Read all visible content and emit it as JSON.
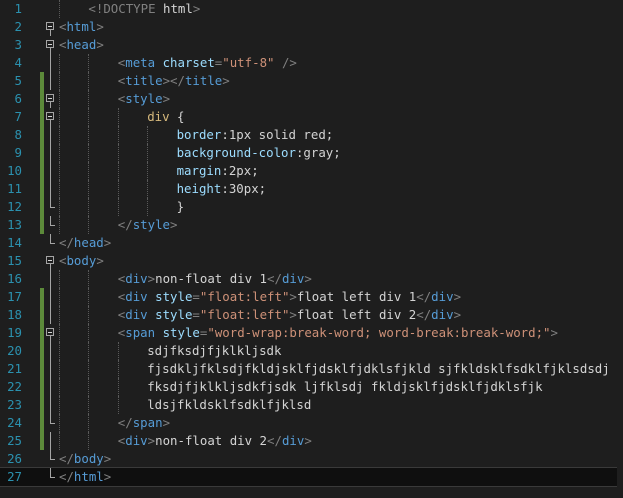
{
  "editor": {
    "current_line": 27,
    "colors": {
      "background": "#1e1e1e",
      "line_number": "#2b91af",
      "delimiter": "#808080",
      "tag": "#569cd6",
      "attribute": "#9cdcfe",
      "string": "#ce9178",
      "selector": "#d7ba7d",
      "text": "#d4d4d4",
      "change_marker": "#5c8a3a"
    },
    "lines": [
      {
        "n": "1",
        "indent": 1,
        "modified": false,
        "fold": "none",
        "tokens": [
          [
            "delim",
            "<!"
          ],
          [
            "doctype",
            "DOCTYPE "
          ],
          [
            "doctype-kw",
            "html"
          ],
          [
            "delim",
            ">"
          ]
        ]
      },
      {
        "n": "2",
        "indent": 0,
        "modified": false,
        "fold": "open",
        "tokens": [
          [
            "delim",
            "<"
          ],
          [
            "tag",
            "html"
          ],
          [
            "delim",
            ">"
          ]
        ]
      },
      {
        "n": "3",
        "indent": 0,
        "modified": false,
        "fold": "open",
        "tokens": [
          [
            "delim",
            "<"
          ],
          [
            "tag",
            "head"
          ],
          [
            "delim",
            ">"
          ]
        ]
      },
      {
        "n": "4",
        "indent": 2,
        "modified": false,
        "fold": "line",
        "tokens": [
          [
            "delim",
            "<"
          ],
          [
            "tag",
            "meta "
          ],
          [
            "attr",
            "charset"
          ],
          [
            "delim",
            "="
          ],
          [
            "str",
            "\"utf-8\""
          ],
          [
            "delim",
            " />"
          ]
        ]
      },
      {
        "n": "5",
        "indent": 2,
        "modified": true,
        "fold": "line",
        "tokens": [
          [
            "delim",
            "<"
          ],
          [
            "tag",
            "title"
          ],
          [
            "delim",
            "></"
          ],
          [
            "tag",
            "title"
          ],
          [
            "delim",
            ">"
          ]
        ]
      },
      {
        "n": "6",
        "indent": 2,
        "modified": true,
        "fold": "open",
        "tokens": [
          [
            "delim",
            "<"
          ],
          [
            "tag",
            "style"
          ],
          [
            "delim",
            ">"
          ]
        ]
      },
      {
        "n": "7",
        "indent": 3,
        "modified": true,
        "fold": "open",
        "tokens": [
          [
            "sel",
            "div "
          ],
          [
            "text",
            "{"
          ]
        ]
      },
      {
        "n": "8",
        "indent": 4,
        "modified": true,
        "fold": "line",
        "tokens": [
          [
            "prop",
            "border"
          ],
          [
            "text",
            ":1px solid red;"
          ]
        ]
      },
      {
        "n": "9",
        "indent": 4,
        "modified": true,
        "fold": "line",
        "tokens": [
          [
            "prop",
            "background-color"
          ],
          [
            "text",
            ":gray;"
          ]
        ]
      },
      {
        "n": "10",
        "indent": 4,
        "modified": true,
        "fold": "line",
        "tokens": [
          [
            "prop",
            "margin"
          ],
          [
            "text",
            ":2px;"
          ]
        ]
      },
      {
        "n": "11",
        "indent": 4,
        "modified": true,
        "fold": "line",
        "tokens": [
          [
            "prop",
            "height"
          ],
          [
            "text",
            ":30px;"
          ]
        ]
      },
      {
        "n": "12",
        "indent": 4,
        "modified": true,
        "fold": "end",
        "tokens": [
          [
            "text",
            "}"
          ]
        ]
      },
      {
        "n": "13",
        "indent": 2,
        "modified": true,
        "fold": "end",
        "tokens": [
          [
            "delim",
            "</"
          ],
          [
            "tag",
            "style"
          ],
          [
            "delim",
            ">"
          ]
        ]
      },
      {
        "n": "14",
        "indent": 0,
        "modified": false,
        "fold": "end",
        "tokens": [
          [
            "delim",
            "</"
          ],
          [
            "tag",
            "head"
          ],
          [
            "delim",
            ">"
          ]
        ]
      },
      {
        "n": "15",
        "indent": 0,
        "modified": false,
        "fold": "open",
        "tokens": [
          [
            "delim",
            "<"
          ],
          [
            "tag",
            "body"
          ],
          [
            "delim",
            ">"
          ]
        ]
      },
      {
        "n": "16",
        "indent": 2,
        "modified": false,
        "fold": "line",
        "tokens": [
          [
            "delim",
            "<"
          ],
          [
            "tag",
            "div"
          ],
          [
            "delim",
            ">"
          ],
          [
            "text",
            "non-float div 1"
          ],
          [
            "delim",
            "</"
          ],
          [
            "tag",
            "div"
          ],
          [
            "delim",
            ">"
          ]
        ]
      },
      {
        "n": "17",
        "indent": 2,
        "modified": true,
        "fold": "line",
        "tokens": [
          [
            "delim",
            "<"
          ],
          [
            "tag",
            "div "
          ],
          [
            "attr",
            "style"
          ],
          [
            "delim",
            "="
          ],
          [
            "str",
            "\"float:left\""
          ],
          [
            "delim",
            ">"
          ],
          [
            "text",
            "float left div 1"
          ],
          [
            "delim",
            "</"
          ],
          [
            "tag",
            "div"
          ],
          [
            "delim",
            ">"
          ]
        ]
      },
      {
        "n": "18",
        "indent": 2,
        "modified": true,
        "fold": "line",
        "tokens": [
          [
            "delim",
            "<"
          ],
          [
            "tag",
            "div "
          ],
          [
            "attr",
            "style"
          ],
          [
            "delim",
            "="
          ],
          [
            "str",
            "\"float:left\""
          ],
          [
            "delim",
            ">"
          ],
          [
            "text",
            "float left div 2"
          ],
          [
            "delim",
            "</"
          ],
          [
            "tag",
            "div"
          ],
          [
            "delim",
            ">"
          ]
        ]
      },
      {
        "n": "19",
        "indent": 2,
        "modified": true,
        "fold": "open",
        "tokens": [
          [
            "delim",
            "<"
          ],
          [
            "tag",
            "span "
          ],
          [
            "attr",
            "style"
          ],
          [
            "delim",
            "="
          ],
          [
            "str",
            "\"word-wrap:break-word; word-break:break-word;\""
          ],
          [
            "delim",
            ">"
          ]
        ]
      },
      {
        "n": "20",
        "indent": 3,
        "modified": true,
        "fold": "line",
        "tokens": [
          [
            "text",
            "sdjfksdjfjklkljsdk"
          ]
        ]
      },
      {
        "n": "21",
        "indent": 3,
        "modified": true,
        "fold": "line",
        "tokens": [
          [
            "text",
            "fjsdkljfklsdjfkldjsklfjdsklfjdklsfjkld sjfkldsklfsdklfjklsdsdj"
          ]
        ]
      },
      {
        "n": "22",
        "indent": 3,
        "modified": true,
        "fold": "line",
        "tokens": [
          [
            "text",
            "fksdjfjklkljsdkfjsdk ljfklsdj fkldjsklfjdsklfjdklsfjk"
          ]
        ]
      },
      {
        "n": "23",
        "indent": 3,
        "modified": true,
        "fold": "line",
        "tokens": [
          [
            "text",
            "ldsjfkldsklfsdklfjklsd"
          ]
        ]
      },
      {
        "n": "24",
        "indent": 2,
        "modified": true,
        "fold": "end",
        "tokens": [
          [
            "delim",
            "</"
          ],
          [
            "tag",
            "span"
          ],
          [
            "delim",
            ">"
          ]
        ]
      },
      {
        "n": "25",
        "indent": 2,
        "modified": true,
        "fold": "line",
        "tokens": [
          [
            "delim",
            "<"
          ],
          [
            "tag",
            "div"
          ],
          [
            "delim",
            ">"
          ],
          [
            "text",
            "non-float div 2"
          ],
          [
            "delim",
            "</"
          ],
          [
            "tag",
            "div"
          ],
          [
            "delim",
            ">"
          ]
        ]
      },
      {
        "n": "26",
        "indent": 0,
        "modified": false,
        "fold": "end",
        "tokens": [
          [
            "delim",
            "</"
          ],
          [
            "tag",
            "body"
          ],
          [
            "delim",
            ">"
          ]
        ]
      },
      {
        "n": "27",
        "indent": 0,
        "modified": false,
        "fold": "end",
        "tokens": [
          [
            "delim",
            "</"
          ],
          [
            "tag",
            "html"
          ],
          [
            "delim",
            ">"
          ]
        ]
      }
    ]
  }
}
